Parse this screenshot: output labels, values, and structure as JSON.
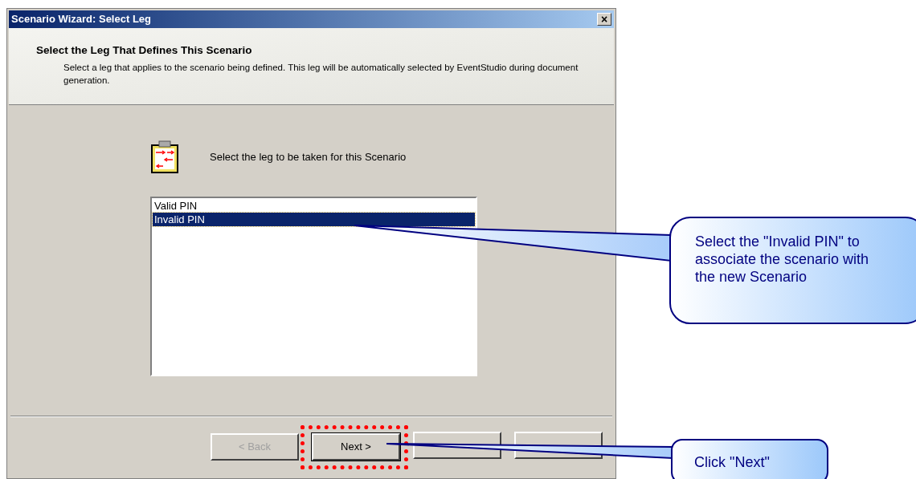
{
  "window": {
    "title": "Scenario Wizard: Select Leg",
    "close": "×"
  },
  "header": {
    "title": "Select the Leg That Defines This Scenario",
    "description": "Select a leg that applies to the scenario being defined. This leg will be automatically selected by EventStudio during document generation."
  },
  "prompt": "Select the leg to be taken for this Scenario",
  "legs": [
    {
      "label": "Valid PIN",
      "selected": false
    },
    {
      "label": "Invalid PIN",
      "selected": true
    }
  ],
  "buttons": [
    {
      "label": "< Back",
      "disabled": true,
      "highlighted": false
    },
    {
      "label": "Next >",
      "disabled": false,
      "highlighted": true
    },
    {
      "highlighted": false
    },
    {
      "highlighted": false
    }
  ],
  "callouts": [
    {
      "text": "Select the \"Invalid PIN\" to associate the scenario with the new Scenario"
    },
    {
      "text": "Click \"Next\""
    }
  ]
}
